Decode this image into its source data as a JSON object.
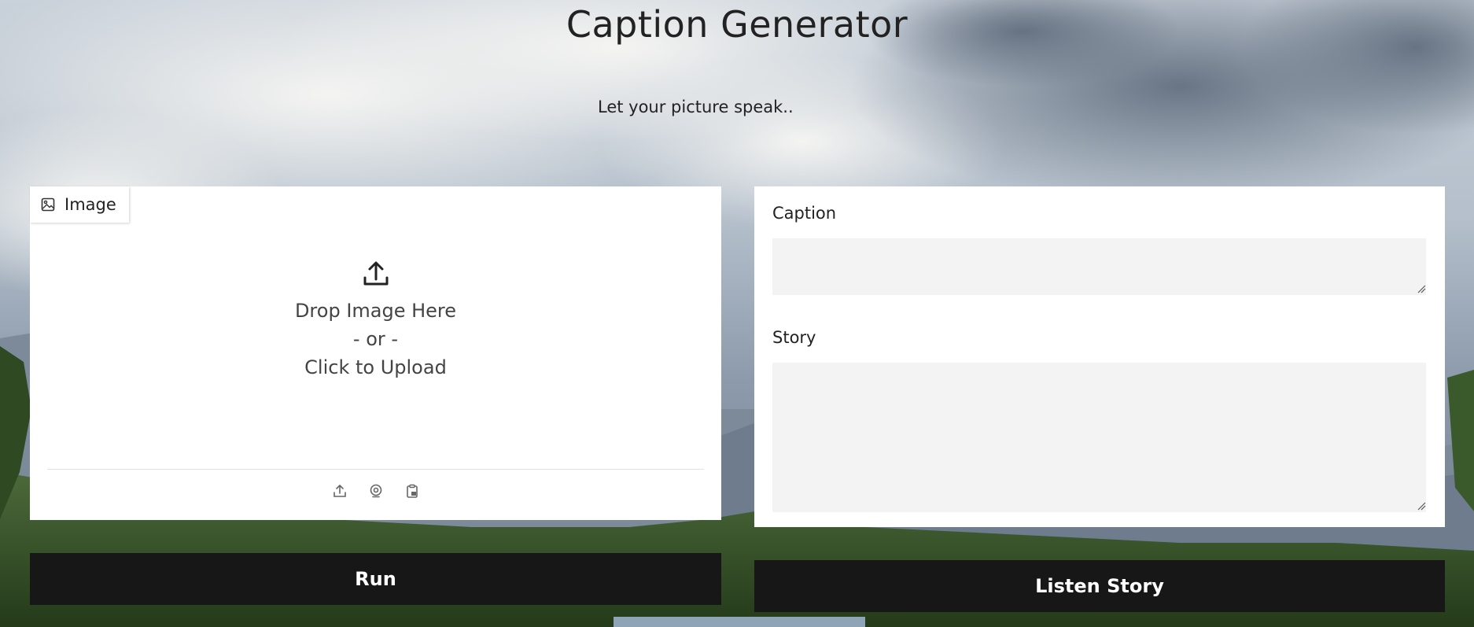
{
  "header": {
    "title": "Caption Generator",
    "subtitle": "Let your picture speak.."
  },
  "image_panel": {
    "tab_label": "Image",
    "tab_icon": "image-icon",
    "upload_icon": "upload-icon",
    "drop_text": "Drop Image Here",
    "or_text": "- or -",
    "click_text": "Click to Upload",
    "sources": [
      {
        "name": "upload-source",
        "icon": "upload-icon"
      },
      {
        "name": "webcam-source",
        "icon": "webcam-icon"
      },
      {
        "name": "clipboard-source",
        "icon": "clipboard-icon"
      }
    ]
  },
  "output_panel": {
    "caption_label": "Caption",
    "caption_value": "",
    "story_label": "Story",
    "story_value": ""
  },
  "actions": {
    "run_label": "Run",
    "listen_label": "Listen Story"
  },
  "colors": {
    "button_bg": "#171717",
    "panel_bg": "#ffffff",
    "field_bg": "#f3f3f3",
    "text": "#222222"
  }
}
